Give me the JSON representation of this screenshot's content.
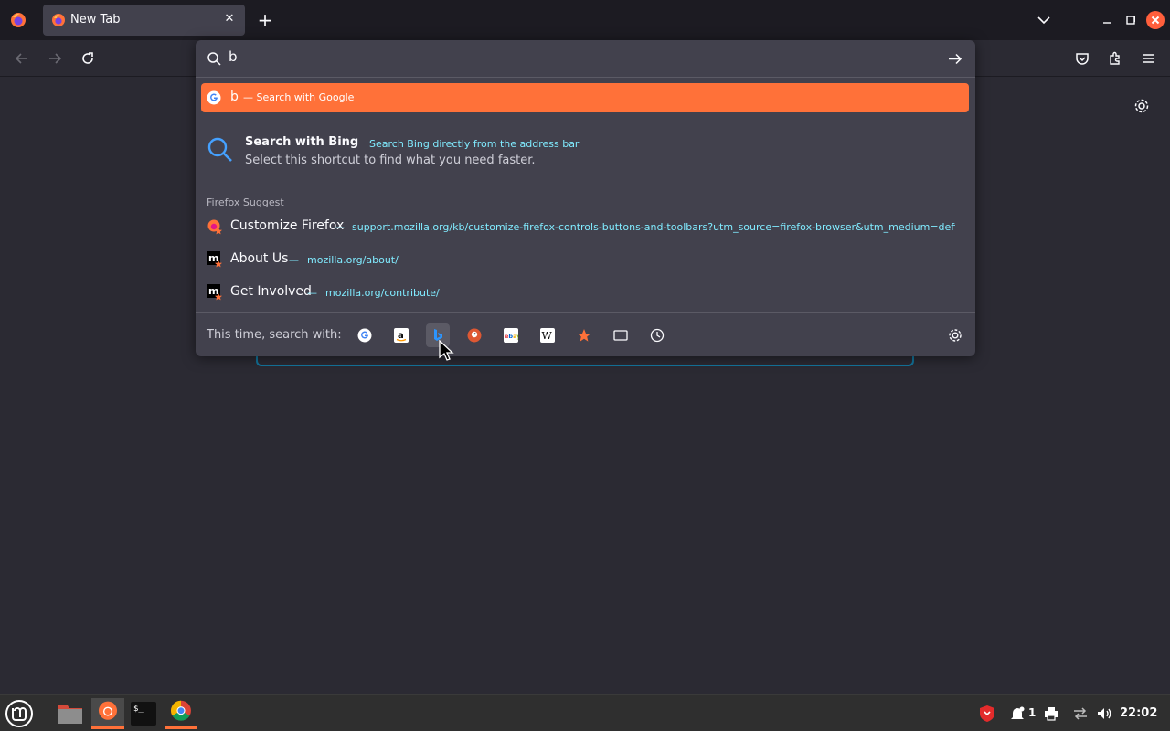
{
  "tab": {
    "title": "New Tab",
    "close_glyph": "✕"
  },
  "toolbar": {
    "new_tab_glyph": "+"
  },
  "urlbar": {
    "typed": "b",
    "results": {
      "google": {
        "query": "b",
        "action": "— Search with Google"
      },
      "bing": {
        "title": "Search with Bing",
        "separator": "—",
        "subtitle": "Search Bing directly from the address bar",
        "description": "Select this shortcut to find what you need faster."
      },
      "suggest_heading": "Firefox Suggest",
      "suggestions": [
        {
          "title": "Customize Firefox",
          "separator": "—",
          "url": "support.mozilla.org/kb/customize-firefox-controls-buttons-and-toolbars?utm_source=firefox-browser&utm_medium=defi"
        },
        {
          "title": "About Us",
          "separator": "—",
          "url": "mozilla.org/about/"
        },
        {
          "title": "Get Involved",
          "separator": "—",
          "url": "mozilla.org/contribute/"
        }
      ]
    },
    "oneoff_label": "This time, search with:",
    "engines": [
      "google-icon",
      "amazon-icon",
      "bing-icon",
      "duckduckgo-icon",
      "ebay-icon",
      "wikipedia-icon",
      "bookmarks-icon",
      "tabs-icon",
      "history-icon"
    ]
  },
  "taskbar": {
    "notification_count": "1",
    "clock": "22:02"
  },
  "colors": {
    "accent": "#ff7139",
    "link": "#80ebff",
    "popup_bg": "#42414d",
    "page_bg": "#2b2a33"
  }
}
